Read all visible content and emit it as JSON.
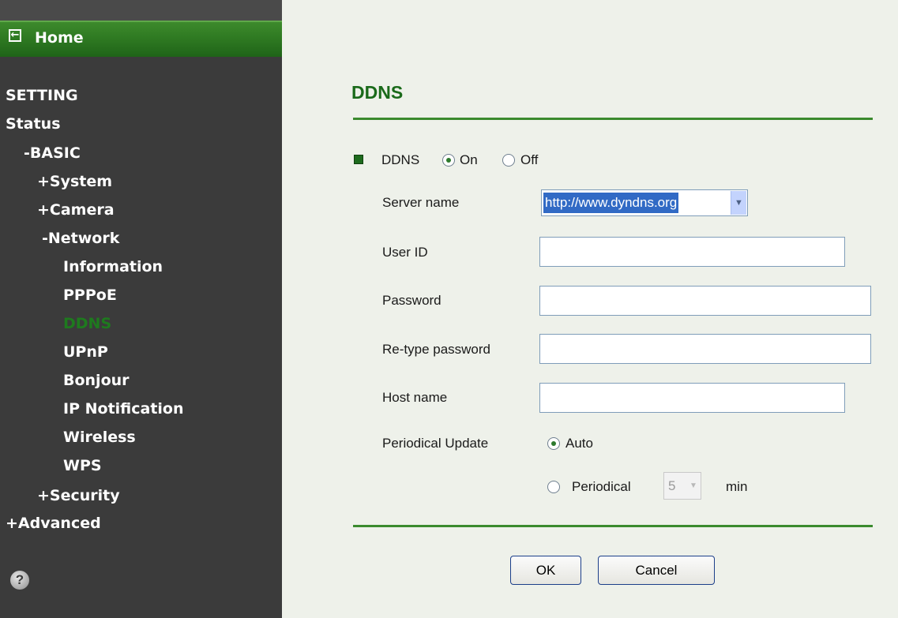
{
  "sidebar": {
    "home_label": "Home",
    "setting": "SETTING",
    "status": "Status",
    "basic": "-BASIC",
    "system": "+System",
    "camera": "+Camera",
    "network": "-Network",
    "network_items": [
      "Information",
      "PPPoE",
      "DDNS",
      "UPnP",
      "Bonjour",
      "IP Notification",
      "Wireless",
      "WPS"
    ],
    "active_item": "DDNS",
    "security": "+Security",
    "advanced": "+Advanced",
    "help_glyph": "?"
  },
  "page": {
    "title": "DDNS"
  },
  "ddns": {
    "label": "DDNS",
    "on_label": "On",
    "off_label": "Off",
    "selected": "On"
  },
  "form": {
    "server_name_label": "Server name",
    "server_name_value": "http://www.dyndns.org",
    "user_id_label": "User ID",
    "user_id_value": "",
    "password_label": "Password",
    "password_value": "",
    "retype_label": "Re-type password",
    "retype_value": "",
    "host_label": "Host name",
    "host_value": "",
    "periodical_update_label": "Periodical Update",
    "auto_label": "Auto",
    "periodical_label": "Periodical",
    "periodical_value": "5",
    "min_label": "min",
    "update_mode": "Auto"
  },
  "buttons": {
    "ok": "OK",
    "cancel": "Cancel"
  },
  "colors": {
    "sidebar_bg": "#3b3b3b",
    "accent_green": "#1a6a1a",
    "active_nav": "#1e7a1e",
    "main_bg": "#eef1ea"
  },
  "icons": {
    "home": "back-arrow-icon",
    "help": "help-icon",
    "bullet": "square-bullet-icon"
  }
}
